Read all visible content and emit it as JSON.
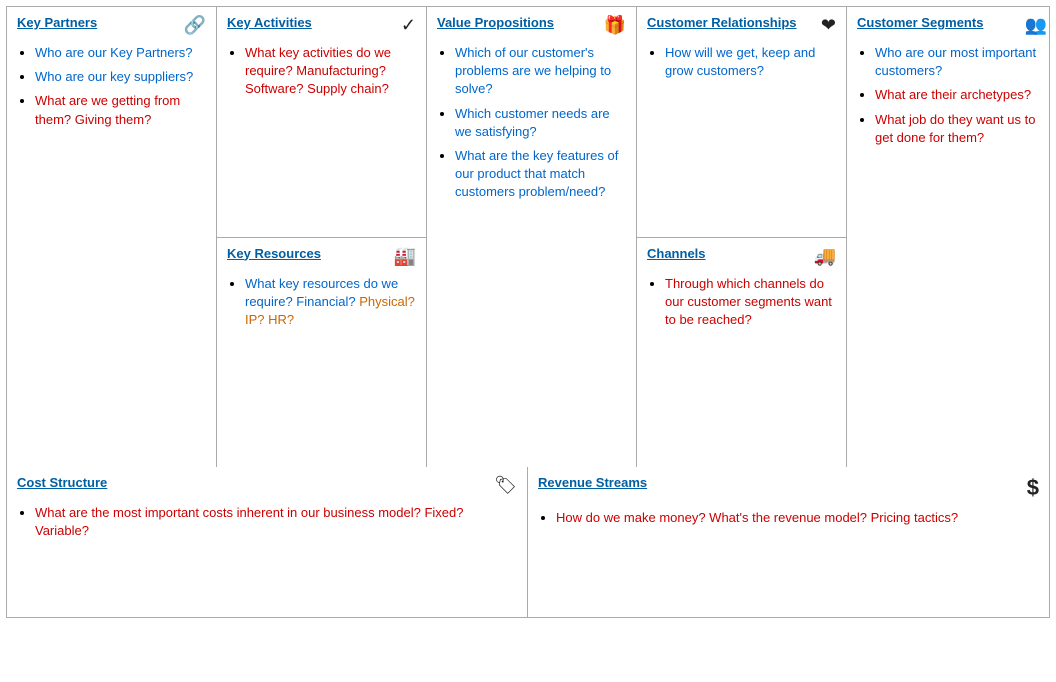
{
  "sections": {
    "keyPartners": {
      "title": "Key Partners",
      "icon": "🔗",
      "items": [
        {
          "text": "Who are our Key Partners?",
          "color": "blue"
        },
        {
          "text": "Who are our key suppliers?",
          "color": "blue"
        },
        {
          "text": "What are we getting from them? Giving them?",
          "color": "red"
        }
      ]
    },
    "keyActivities": {
      "title": "Key Activities",
      "icon": "✔",
      "items": [
        {
          "text": "What key activities do we require? Manufacturing? Software? Supply chain?",
          "color": "red"
        }
      ]
    },
    "keyResources": {
      "title": "Key Resources",
      "icon": "🏭",
      "items": [
        {
          "text": "What key resources do we require? Financial?",
          "part1": "What key resources do we require? Financial?",
          "part2": " Physical? IP? HR?",
          "color": "mixed"
        }
      ]
    },
    "valuePropositions": {
      "title": "Value Propositions",
      "icon": "🎁",
      "items": [
        {
          "text": "Which of our customer's problems are we helping to solve?",
          "color": "blue"
        },
        {
          "text": "Which customer needs are we satisfying?",
          "color": "blue"
        },
        {
          "text": "What are the key features of our product that match customers problem/need?",
          "color": "blue"
        }
      ]
    },
    "customerRelationships": {
      "title": "Customer Relationships",
      "icon": "♥",
      "items": [
        {
          "text": "How will we get, keep and grow customers?",
          "color": "blue"
        }
      ]
    },
    "channels": {
      "title": "Channels",
      "icon": "🚚",
      "items": [
        {
          "text": "Through which channels do our customer segments want to be reached?",
          "color": "red"
        }
      ]
    },
    "customerSegments": {
      "title": "Customer Segments",
      "icon": "👥",
      "items": [
        {
          "text": "Who are our most important customers?",
          "color": "blue"
        },
        {
          "text": "What are their archetypes?",
          "color": "red"
        },
        {
          "text": "What job do they want us to get done for them?",
          "color": "red"
        }
      ]
    },
    "costStructure": {
      "title": "Cost Structure",
      "icon": "🏷",
      "items": [
        {
          "text": "What are the most important costs inherent in our business model? Fixed? Variable?",
          "color": "red"
        }
      ]
    },
    "revenueStreams": {
      "title": "Revenue Streams",
      "icon": "$",
      "items": [
        {
          "text": "How do we make money? What's the revenue model? Pricing tactics?",
          "color": "red"
        }
      ]
    }
  }
}
